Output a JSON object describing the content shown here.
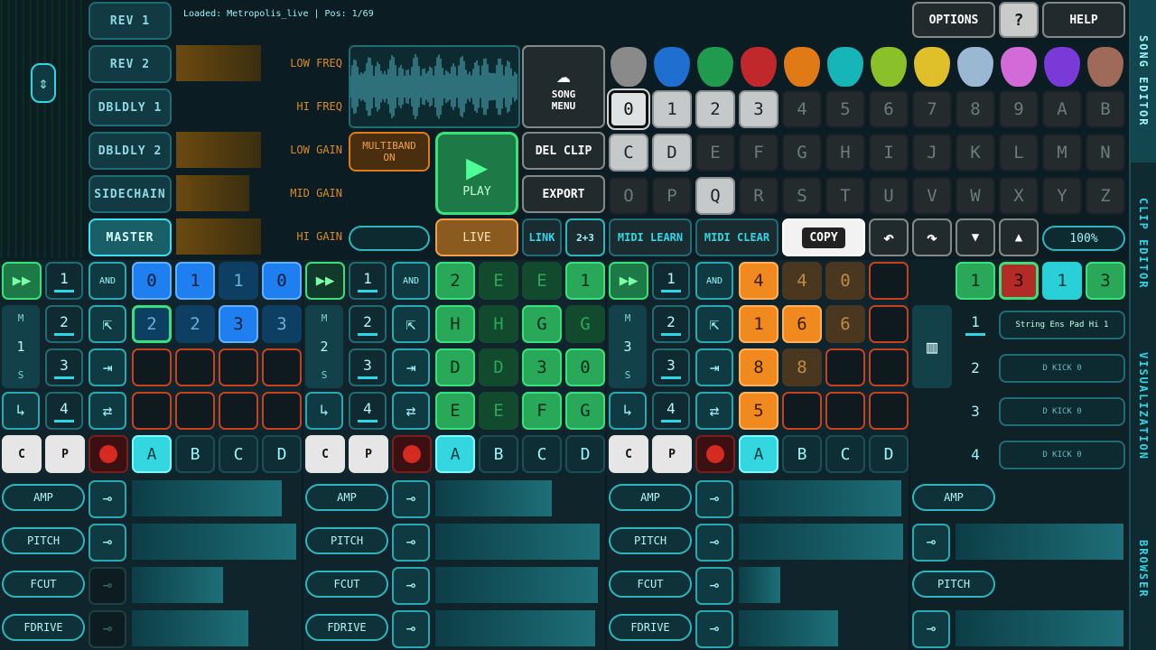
{
  "status": {
    "text": "Loaded: Metropolis_live | Pos: 1/69"
  },
  "fx": [
    "REV 1",
    "REV 2",
    "DBLDLY 1",
    "DBLDLY 2",
    "SIDECHAIN",
    "MASTER"
  ],
  "eq": [
    "LOW FREQ",
    "HI FREQ",
    "LOW GAIN",
    "MID GAIN",
    "HI GAIN"
  ],
  "multiband": {
    "line1": "MULTIBAND",
    "line2": "ON"
  },
  "song_menu": {
    "line1": "SONG",
    "line2": "MENU"
  },
  "play": "PLAY",
  "del_clip": "DEL CLIP",
  "export": "EXPORT",
  "live": "LIVE",
  "link": "LINK",
  "link2": "2+3",
  "midi_learn": "MIDI LEARN",
  "midi_clear": "MIDI CLEAR",
  "copy": "COPY",
  "zoom": "100%",
  "top": {
    "options": "OPTIONS",
    "question": "?",
    "help": "HELP"
  },
  "picks_colors": [
    "#8a8a8a",
    "#1e6fd0",
    "#1f9a4e",
    "#c0282b",
    "#e07a16",
    "#16b5b8",
    "#8ac02a",
    "#e0c02a",
    "#9ab8d2",
    "#d26ad8",
    "#7a3ad8",
    "#a06a5a"
  ],
  "keys_row1": [
    "0",
    "1",
    "2",
    "3",
    "4",
    "5",
    "6",
    "7",
    "8",
    "9",
    "A",
    "B"
  ],
  "keys_row2": [
    "C",
    "D",
    "E",
    "F",
    "G",
    "H",
    "I",
    "J",
    "K",
    "L",
    "M",
    "N"
  ],
  "keys_row3": [
    "O",
    "P",
    "Q",
    "R",
    "S",
    "T",
    "U",
    "V",
    "W",
    "X",
    "Y",
    "Z"
  ],
  "side_tabs": [
    "SONG EDITOR",
    "CLIP EDITOR",
    "VISUALIZATION",
    "BROWSER"
  ],
  "tracks": [
    {
      "number": "1",
      "m": "M",
      "s": "S",
      "pads": [
        [
          "0",
          "1",
          "1",
          "0"
        ],
        [
          "2",
          "2",
          "3",
          "3"
        ],
        [
          "",
          "",
          "",
          ""
        ],
        [
          "",
          "",
          "",
          ""
        ]
      ]
    },
    {
      "number": "2",
      "m": "M",
      "s": "S",
      "pads": [
        [
          "2",
          "E",
          "E",
          "1"
        ],
        [
          "H",
          "H",
          "G",
          "G"
        ],
        [
          "D",
          "D",
          "3",
          "0"
        ],
        [
          "E",
          "E",
          "F",
          "G"
        ]
      ]
    },
    {
      "number": "3",
      "m": "M",
      "s": "S",
      "pads": [
        [
          "4",
          "4",
          "0",
          ""
        ],
        [
          "1",
          "6",
          "6",
          ""
        ],
        [
          "8",
          "8",
          "",
          ""
        ],
        [
          "5",
          "",
          "",
          ""
        ]
      ]
    }
  ],
  "rows": [
    "1",
    "2",
    "3",
    "4"
  ],
  "and_label": "AND",
  "abcd": [
    "A",
    "B",
    "C",
    "D"
  ],
  "mods": [
    "AMP",
    "PITCH",
    "FCUT",
    "FDRIVE"
  ],
  "panel4": {
    "pads": [
      "1",
      "3",
      "1",
      "3"
    ],
    "rows": [
      "1",
      "2",
      "3",
      "4"
    ],
    "slots": [
      "String Ens Pad Hi 1",
      "D KICK 0",
      "D KICK 0",
      "D KICK 0"
    ],
    "mods": [
      "AMP",
      "PITCH"
    ]
  },
  "c_label": "C",
  "p_label": "P"
}
